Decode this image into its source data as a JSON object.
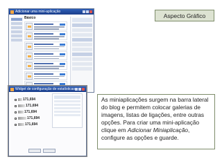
{
  "slide": {
    "title": "Aspecto Gráfico",
    "body_parts": [
      "As miniaplicações surgem na barra lateral do blog e permitem colocar galerias de imagens, listas de ligações, entre outras opções. Para criar uma mini-aplicação clique em ",
      "Adicionar Miniaplicação",
      ", configure as opções e guarde."
    ]
  },
  "screenshot1": {
    "window_title": "Adicionar uma mini-aplicação",
    "section_title": "Básico",
    "items": [
      {
        "name": "Gadget"
      },
      {
        "name": "Gadget"
      },
      {
        "name": "Gadget"
      },
      {
        "name": "Gadget"
      },
      {
        "name": "Gadget"
      },
      {
        "name": "Gadget"
      },
      {
        "name": "Gadget"
      }
    ]
  },
  "screenshot2": {
    "window_title": "Widget de configuração de estatísticas",
    "counters": [
      {
        "value": "171,694"
      },
      {
        "value": "171,694"
      },
      {
        "value": "171,694"
      },
      {
        "value": "171,694"
      },
      {
        "value": "171,694"
      }
    ]
  }
}
